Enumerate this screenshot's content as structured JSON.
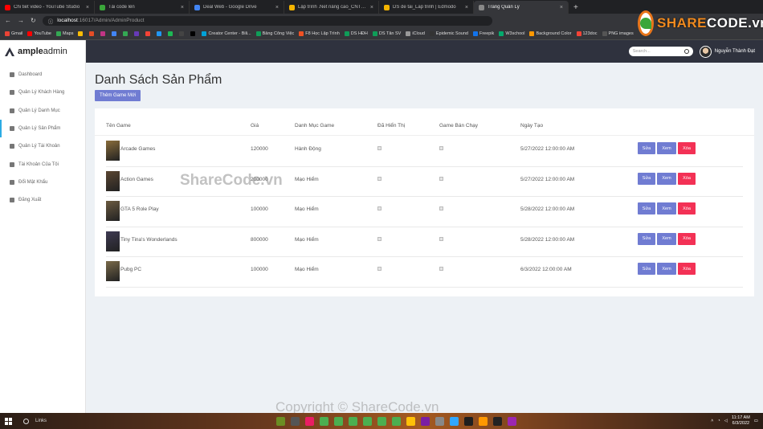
{
  "browser": {
    "tabs": [
      {
        "title": "Chi tiết video - YouTube Studio",
        "color": "#ff0000",
        "active": false
      },
      {
        "title": "Tải code lên",
        "color": "#3aa63a",
        "active": false
      },
      {
        "title": "Deal Web - Google Drive",
        "color": "#4285f4",
        "active": false
      },
      {
        "title": "Lập trình .Net nâng cao_CNTT13",
        "color": "#f4b400",
        "active": false
      },
      {
        "title": "DS de tai_Lap trinh | Edmodo",
        "color": "#f4b400",
        "active": false
      },
      {
        "title": "Trang Quản Lý",
        "color": "#888888",
        "active": true
      }
    ],
    "new_tab": "+",
    "url_host": "localhost",
    "url_path": ":16017/Admin/AdminProduct",
    "bookmarks": [
      {
        "label": "Gmail",
        "color": "#ea4335"
      },
      {
        "label": "YouTube",
        "color": "#ff0000"
      },
      {
        "label": "Maps",
        "color": "#34a853"
      },
      {
        "label": "",
        "color": "#fbbc05"
      },
      {
        "label": "",
        "color": "#e44d26"
      },
      {
        "label": "",
        "color": "#c13584"
      },
      {
        "label": "",
        "color": "#4285f4"
      },
      {
        "label": "",
        "color": "#34a853"
      },
      {
        "label": "",
        "color": "#673ab7"
      },
      {
        "label": "",
        "color": "#f44336"
      },
      {
        "label": "",
        "color": "#2196f3"
      },
      {
        "label": "",
        "color": "#1db954"
      },
      {
        "label": "",
        "color": "#444444"
      },
      {
        "label": "",
        "color": "#000000"
      },
      {
        "label": "Creator Center - Bili...",
        "color": "#00a1d6"
      },
      {
        "label": "Bảng Công Việc",
        "color": "#0f9d58"
      },
      {
        "label": "F8 Học Lập Trình",
        "color": "#f05123"
      },
      {
        "label": "DS HĐH",
        "color": "#0f9d58"
      },
      {
        "label": "DS Tân SV",
        "color": "#0f9d58"
      },
      {
        "label": "iCloud",
        "color": "#999999"
      },
      {
        "label": "Epidemic Sound",
        "color": "#333333"
      },
      {
        "label": "Freepik",
        "color": "#1273eb"
      },
      {
        "label": "W3school",
        "color": "#04aa6d"
      },
      {
        "label": "Background Color",
        "color": "#ff9800"
      },
      {
        "label": "123doc",
        "color": "#f44336"
      },
      {
        "label": "PNG images",
        "color": "#555555"
      }
    ]
  },
  "watermark_logo": {
    "text_a": "SHARE",
    "text_b": "CODE.vn"
  },
  "sidebar": {
    "brand_bold": "ample",
    "brand_rest": "admin",
    "items": [
      {
        "label": "Dashboard",
        "icon": "clock-icon"
      },
      {
        "label": "Quản Lý Khách Hàng",
        "icon": "user-card-icon"
      },
      {
        "label": "Quản Lý Danh Mục",
        "icon": "table-icon"
      },
      {
        "label": "Quản Lý Sản Phẩm",
        "icon": "gamepad-icon"
      },
      {
        "label": "Quản Lý Tài Khoản",
        "icon": "account-icon"
      },
      {
        "label": "Tài Khoản Của Tôi",
        "icon": "person-icon"
      },
      {
        "label": "Đổi Mật Khẩu",
        "icon": "key-icon"
      },
      {
        "label": "Đăng Xuất",
        "icon": "logout-icon"
      }
    ]
  },
  "topbar": {
    "search_placeholder": "Search...",
    "user_name": "Nguyễn Thành Đạt"
  },
  "main": {
    "title": "Danh Sách Sản Phẩm",
    "add_button": "Thêm Game Mới",
    "columns": [
      "Tên Game",
      "Giá",
      "Danh Mục Game",
      "Đã Hiển Thị",
      "Game Bán Chạy",
      "Ngày Tạo"
    ],
    "rows": [
      {
        "name": "Arcade Games",
        "price": "120000",
        "category": "Hành Động",
        "date": "5/27/2022 12:00:00 AM",
        "thumb": "#8a6d3b"
      },
      {
        "name": "Action Games",
        "price": "200000",
        "category": "Mạo Hiểm",
        "date": "5/27/2022 12:00:00 AM",
        "thumb": "#5a4632"
      },
      {
        "name": "GTA 5 Role Play",
        "price": "100000",
        "category": "Mạo Hiểm",
        "date": "5/28/2022 12:00:00 AM",
        "thumb": "#6b5a40"
      },
      {
        "name": "Tiny Tina's Wonderlands",
        "price": "800000",
        "category": "Mạo Hiểm",
        "date": "5/28/2022 12:00:00 AM",
        "thumb": "#3e3a52"
      },
      {
        "name": "Pubg PC",
        "price": "100000",
        "category": "Mạo Hiểm",
        "date": "6/3/2022 12:00:00 AM",
        "thumb": "#7a6a4a"
      }
    ],
    "btn_edit": "Sửa",
    "btn_view": "Xem",
    "btn_delete": "Xóa"
  },
  "watermarks": {
    "center": "ShareCode.vn",
    "bottom": "Copyright © ShareCode.vn"
  },
  "taskbar": {
    "search_text": "Links",
    "time": "11:17 AM",
    "date": "6/3/2022",
    "apps": [
      "#6b8e23",
      "#555555",
      "#e91e63",
      "#4caf50",
      "#4caf50",
      "#4caf50",
      "#4caf50",
      "#4caf50",
      "#4caf50",
      "#ffc107",
      "#7b1fa2",
      "#888888",
      "#31a8ff",
      "#1f1f1f",
      "#ff9800",
      "#222222",
      "#9c27b0"
    ]
  }
}
